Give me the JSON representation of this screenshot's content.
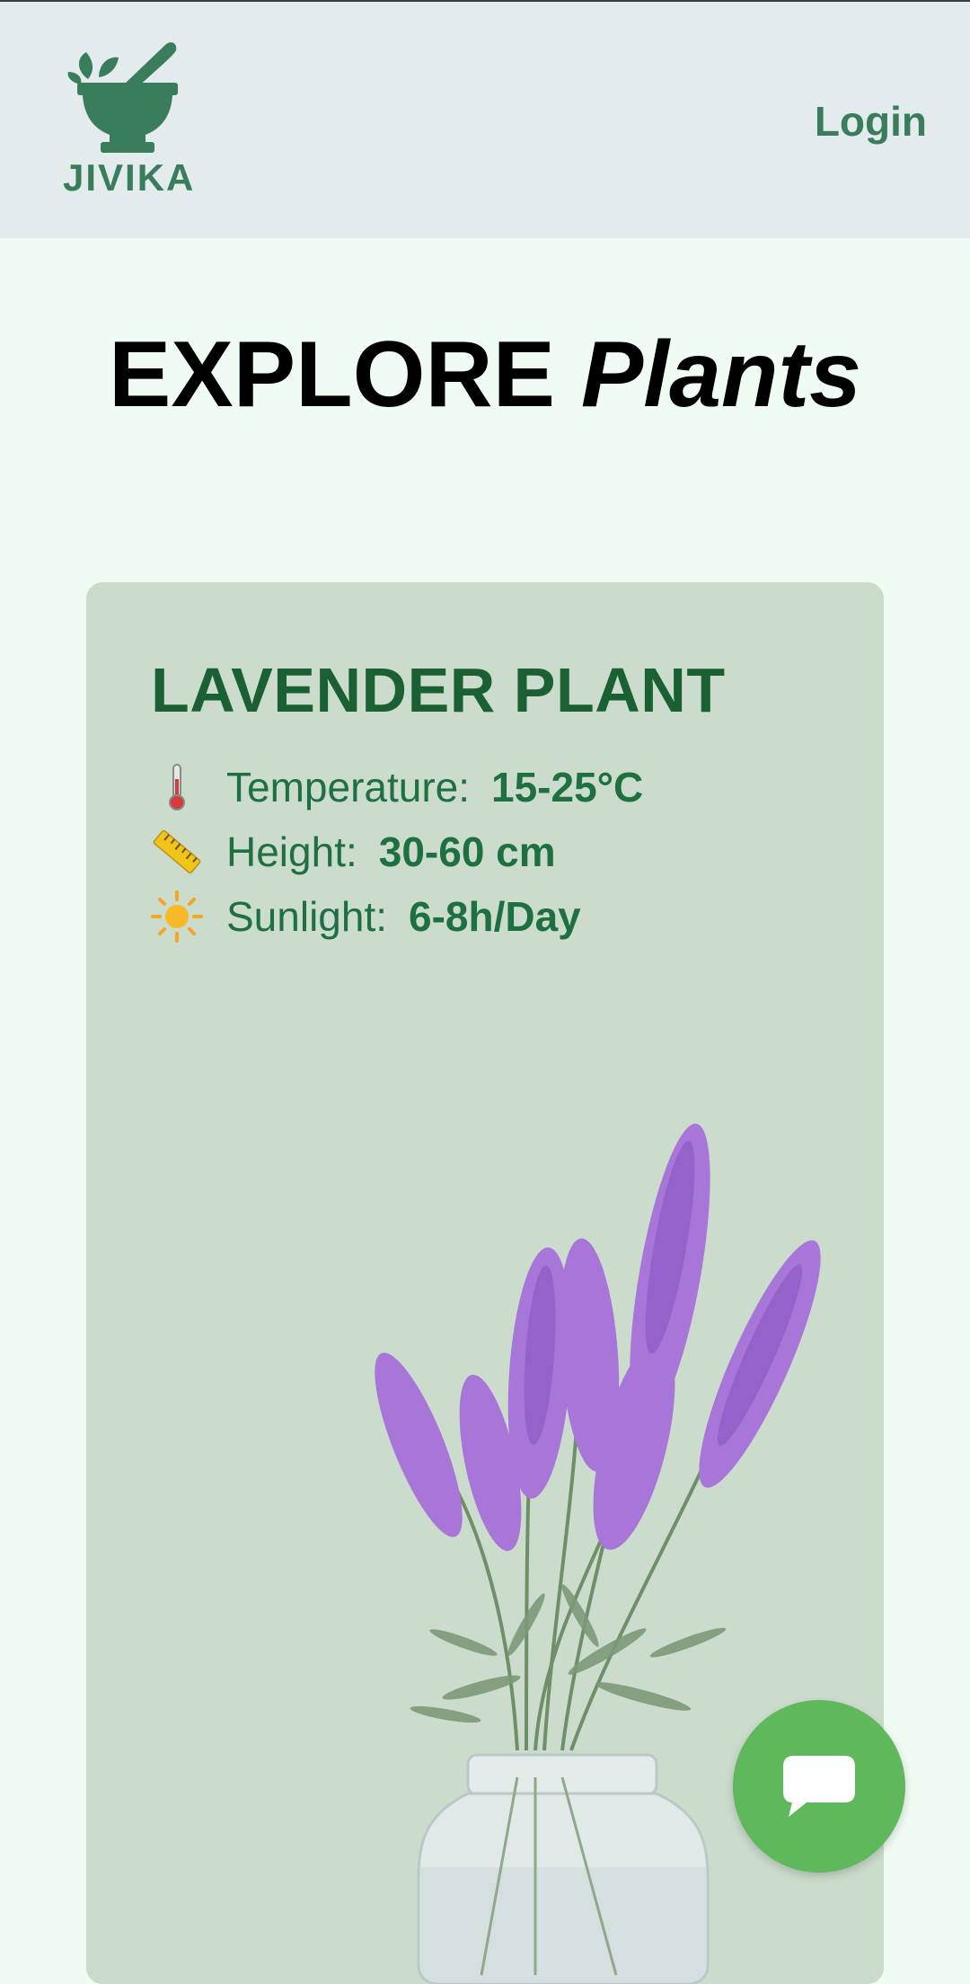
{
  "header": {
    "brand": "JIVIKA",
    "login_label": "Login"
  },
  "page": {
    "title_main": "EXPLORE",
    "title_italic": "Plants"
  },
  "plant_card": {
    "name": "LAVENDER PLANT",
    "stats": [
      {
        "icon": "thermometer-icon",
        "label": "Temperature:",
        "value": "15-25°C"
      },
      {
        "icon": "ruler-icon",
        "label": "Height:",
        "value": "30-60 cm"
      },
      {
        "icon": "sun-icon",
        "label": "Sunlight:",
        "value": "6-8h/Day"
      }
    ]
  },
  "chat": {
    "icon": "chat-bubble-icon"
  },
  "colors": {
    "brand": "#3a7d5d",
    "card_bg": "#cbdccd",
    "plant_name": "#1a6033",
    "chat_button": "#5fb85c"
  }
}
